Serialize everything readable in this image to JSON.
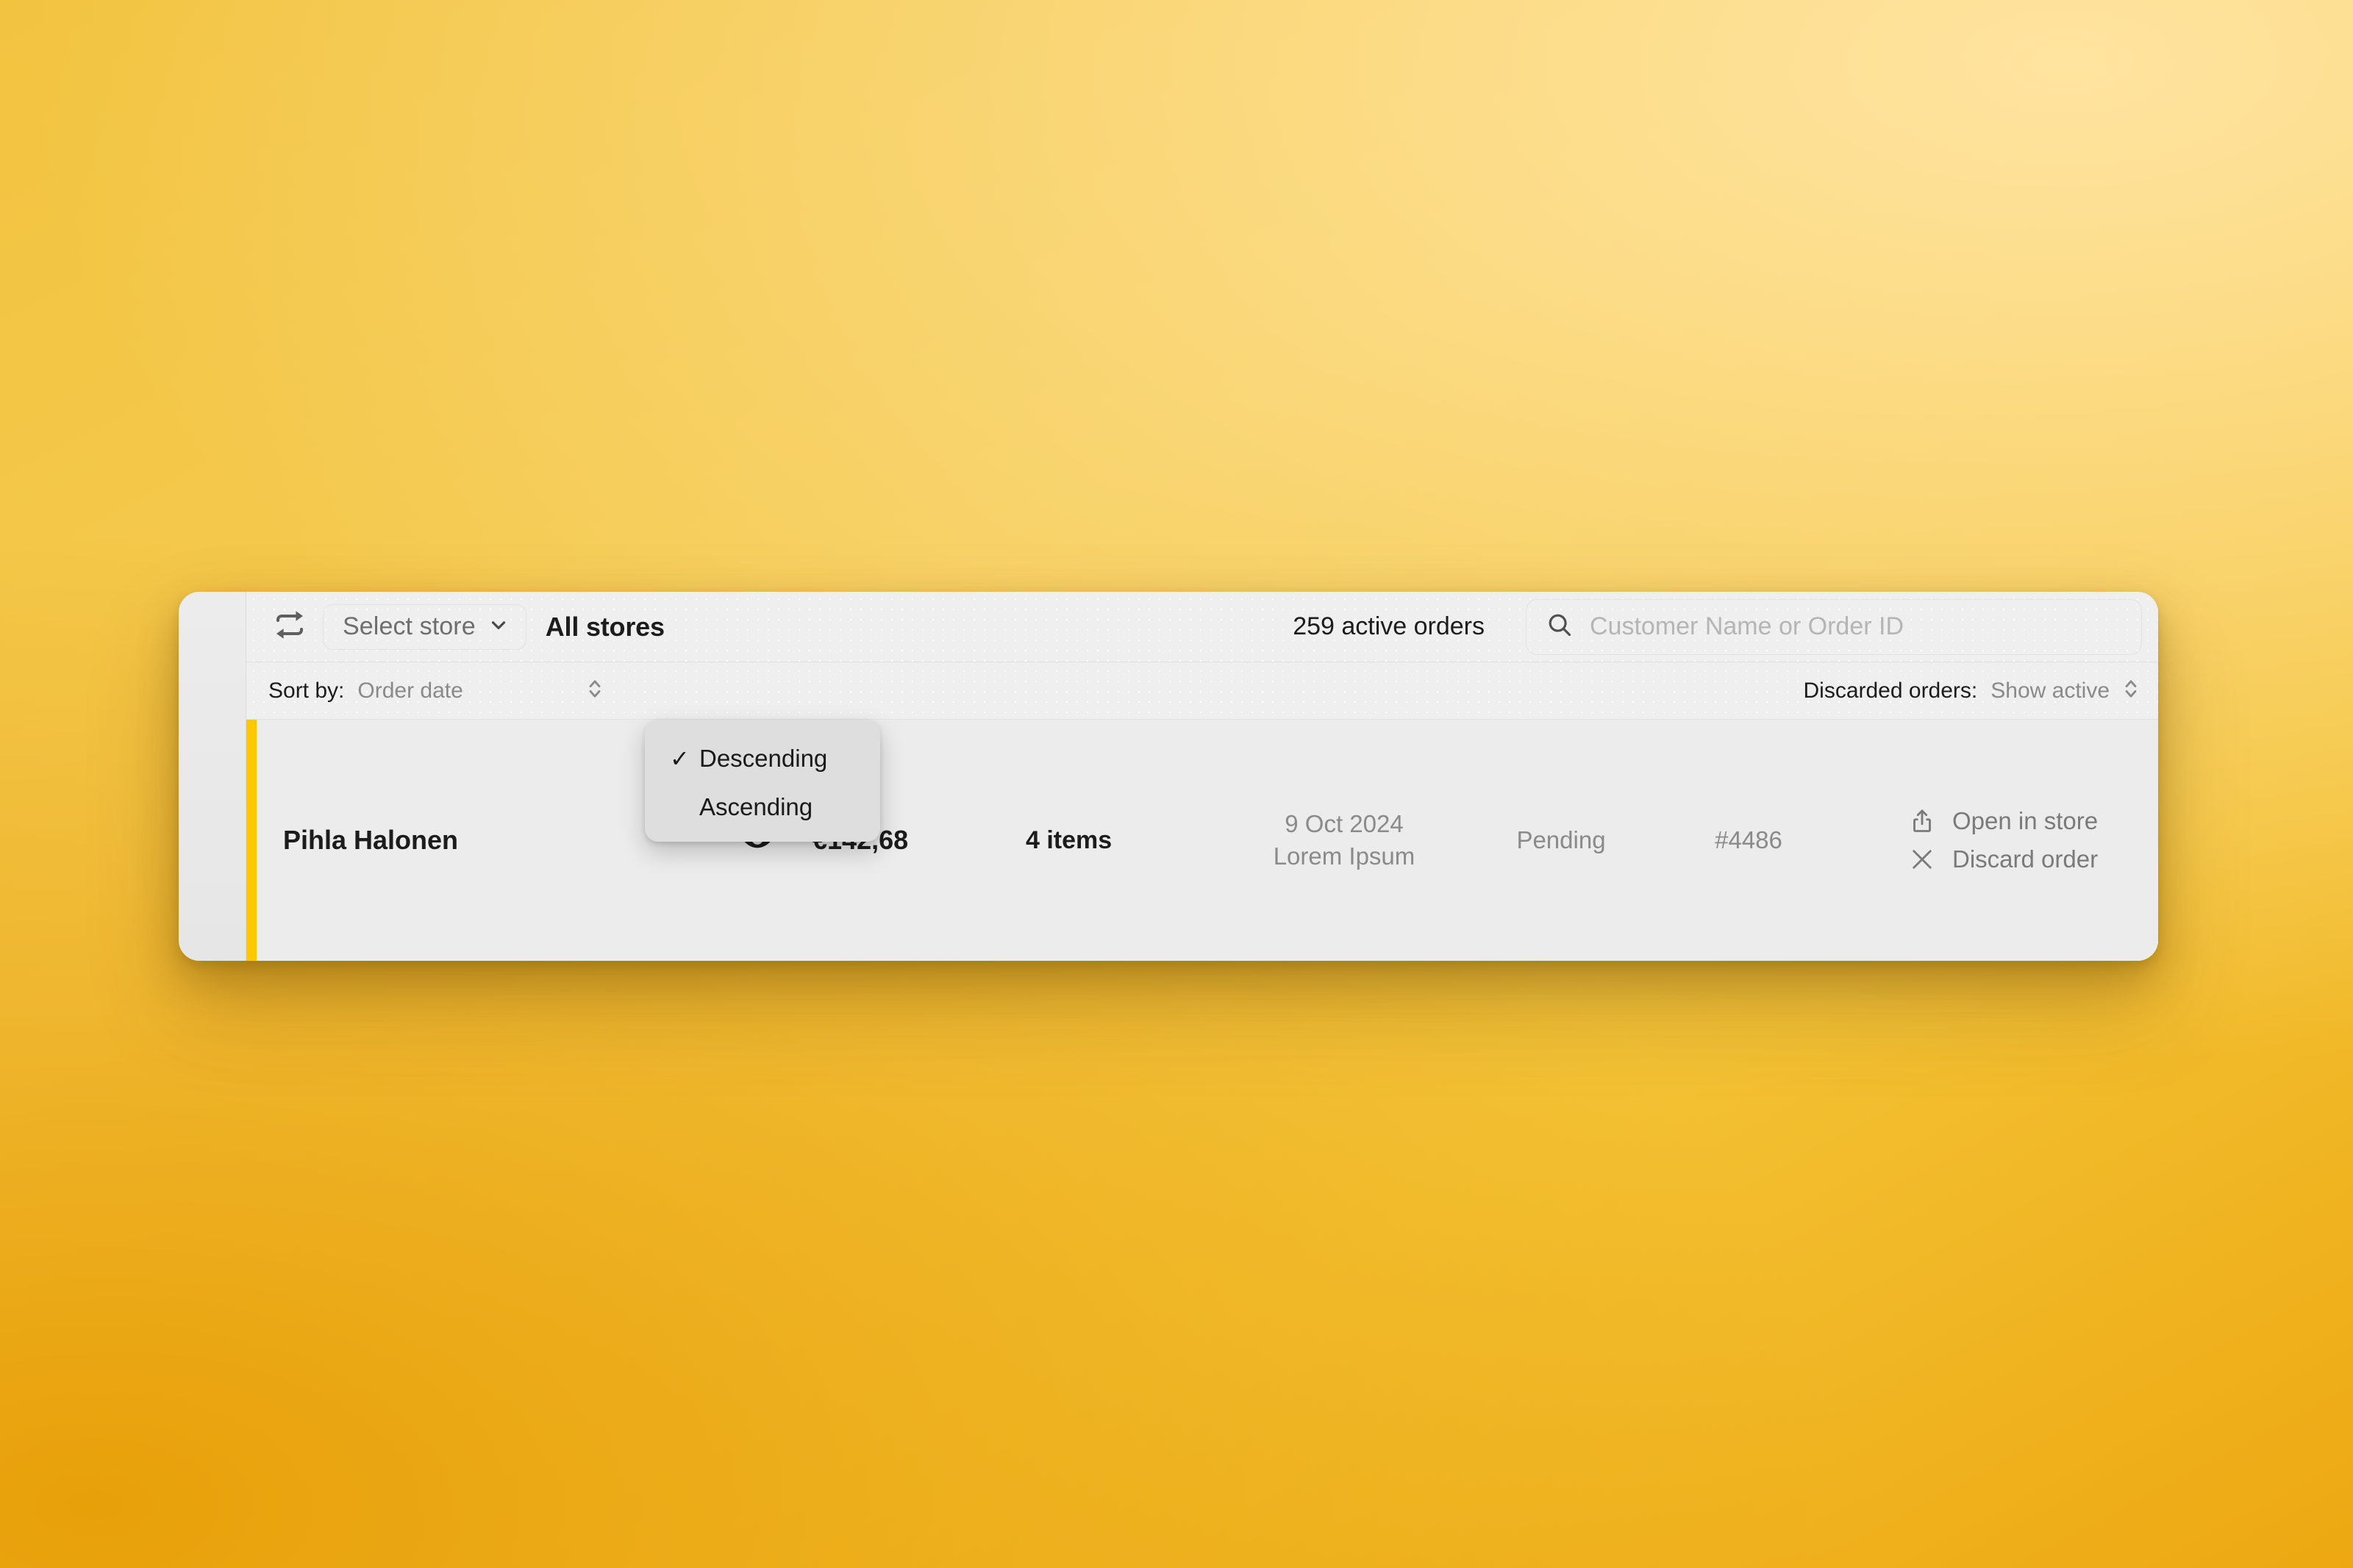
{
  "header": {
    "refresh_icon": "swap-arrows-icon",
    "store_selector_label": "Select store",
    "store_selector_chevron": "chevron-down-icon",
    "current_store": "All stores",
    "active_orders": "259 active orders",
    "search_icon": "search-icon",
    "search_placeholder": "Customer Name or Order ID",
    "search_value": ""
  },
  "sortbar": {
    "sort_label": "Sort by:",
    "sort_value": "Order date",
    "sort_stepper_icon": "chevron-up-down-icon",
    "discarded_label": "Discarded orders:",
    "discarded_value": "Show active",
    "discarded_stepper_icon": "chevron-up-down-icon"
  },
  "sort_popup": {
    "items": [
      {
        "label": "Descending",
        "checked": true,
        "check_glyph": "✓"
      },
      {
        "label": "Ascending",
        "checked": false,
        "check_glyph": ""
      }
    ]
  },
  "orders": [
    {
      "customer": "Pihla Halonen",
      "preview_icon": "eye-icon",
      "price": "€142,68",
      "items": "4 items",
      "date": "9 Oct 2024",
      "date_sub": "Lorem Ipsum",
      "status": "Pending",
      "order_id": "#4486",
      "accent_color": "#FFC700",
      "actions": [
        {
          "icon": "share-icon",
          "label": "Open in store"
        },
        {
          "icon": "close-x-icon",
          "label": "Discard order"
        }
      ]
    }
  ],
  "colors": {
    "accent_yellow": "#FFC700",
    "window_bg": "#EFEFEF",
    "row_bg": "#ECECEC",
    "popup_bg": "#DEDEDE",
    "text_primary": "#1C1C1C",
    "text_muted": "#8A8A8A",
    "backdrop_from": "#F2C33F",
    "backdrop_to": "#EDA811"
  }
}
